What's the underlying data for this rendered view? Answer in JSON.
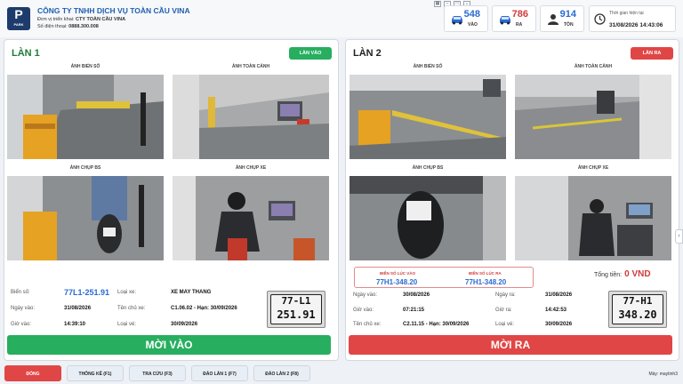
{
  "company": {
    "logo_letter": "P",
    "logo_sub": "PARK",
    "name": "CÔNG TY TNHH DỊCH VỤ TOÀN CẦU VINA",
    "operator_label": "Đơn vị triển khai:",
    "operator": "CTY TOÀN CẦU VINA",
    "phone_label": "Số điện thoại:",
    "phone": "0888.300.008"
  },
  "stats": [
    {
      "icon": "car-in-icon",
      "value": "548",
      "label": "VÀO",
      "color": "#2a6bd1"
    },
    {
      "icon": "car-out-icon",
      "value": "786",
      "label": "RA",
      "color": "#d13a3a"
    },
    {
      "icon": "person-icon",
      "value": "914",
      "label": "TỒN",
      "color": "#2a6bd1"
    }
  ],
  "clock": {
    "label": "Thời gian hiện tại",
    "value": "31/08/2026 14:43:06"
  },
  "lane1": {
    "title": "LÀN 1",
    "mode_button": "LÀN VÀO",
    "captions": [
      "ẢNH BIỂN SỐ",
      "ẢNH TOÀN CẢNH",
      "ẢNH CHỤP BS",
      "ẢNH CHỤP XE"
    ],
    "plate_label": "Biển số:",
    "plate": "77L1-251.91",
    "date_label": "Ngày vào:",
    "date": "31/08/2026",
    "time_label": "Giờ vào:",
    "time": "14:39:10",
    "vehicle_type_label": "Loại xe:",
    "vehicle_type": "XE MAY THANG",
    "owner_label": "Tên chủ xe:",
    "owner": "C1.06.02 - Hạn: 30/09/2026",
    "ticket_type_label": "Loại vé:",
    "ticket_type": "30/09/2026",
    "plate_img_line1": "77-L1",
    "plate_img_line2": "251.91",
    "action": "MỜI VÀO"
  },
  "lane2": {
    "title": "LÀN 2",
    "mode_button": "LÀN RA",
    "captions": [
      "ẢNH BIỂN SỐ",
      "ẢNH TOÀN CẢNH",
      "ẢNH CHỤP BS",
      "ẢNH CHỤP XE"
    ],
    "plate_in_label": "BIỂN SỐ LÚC VÀO",
    "plate_in": "77H1-348.20",
    "plate_out_label": "BIỂN SỐ LÚC RA",
    "plate_out": "77H1-348.20",
    "total_label": "Tổng tiền:",
    "total": "0 VND",
    "date_in_label": "Ngày vào:",
    "date_in": "30/08/2026",
    "time_in_label": "Giờ vào:",
    "time_in": "07:21:15",
    "owner_label": "Tên chủ xe:",
    "owner": "C2.11.15 - Hạn: 30/09/2026",
    "date_out_label": "Ngày ra:",
    "date_out": "31/08/2026",
    "time_out_label": "Giờ ra:",
    "time_out": "14:42:53",
    "ticket_type_label": "Loại vé:",
    "ticket_type": "30/09/2026",
    "plate_img_line1": "77-H1",
    "plate_img_line2": "348.20",
    "action": "MỜI RA"
  },
  "footer": {
    "buttons": [
      "ĐÓNG",
      "THỐNG KÊ (F1)",
      "TRA CỨU (F3)",
      "ĐẢO LÀN 1 (F7)",
      "ĐẢO LÀN 2 (F8)"
    ],
    "machine": "Máy: maytinh3"
  },
  "colors": {
    "green": "#27ae5f",
    "red": "#e04646",
    "blue": "#2a6bd1"
  }
}
